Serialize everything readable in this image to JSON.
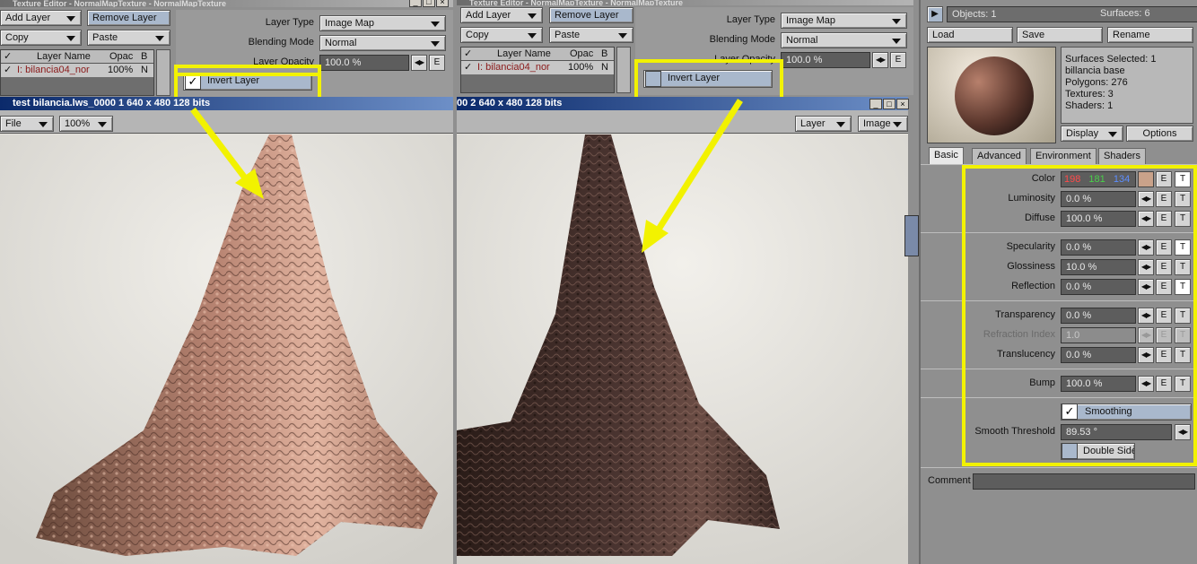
{
  "te1": {
    "title": "Texture Editor - NormalMapTexture - NormalMapTexture",
    "add_layer": "Add Layer",
    "remove_layer": "Remove Layer",
    "copy": "Copy",
    "paste": "Paste",
    "col_layer_name": "Layer Name",
    "col_opac": "Opac",
    "col_b": "B",
    "row_name": "I: bilancia04_nor",
    "row_opac": "100%",
    "row_b": "N",
    "layer_type_label": "Layer Type",
    "layer_type_value": "Image Map",
    "blending_mode_label": "Blending Mode",
    "blending_mode_value": "Normal",
    "layer_opacity_label": "Layer Opacity",
    "layer_opacity_value": "100.0 %",
    "e_label": "E",
    "invert_layer": "Invert Layer"
  },
  "te2": {
    "title": "Texture Editor - NormalMapTexture - NormalMapTexture",
    "add_layer": "Add Layer",
    "remove_layer": "Remove Layer",
    "copy": "Copy",
    "paste": "Paste",
    "col_layer_name": "Layer Name",
    "col_opac": "Opac",
    "col_b": "B",
    "row_name": "I: bilancia04_nor",
    "row_opac": "100%",
    "row_b": "N",
    "layer_type_label": "Layer Type",
    "layer_type_value": "Image Map",
    "blending_mode_label": "Blending Mode",
    "blending_mode_value": "Normal",
    "layer_opacity_label": "Layer Opacity",
    "layer_opacity_value": "100.0 %",
    "e_label": "E",
    "invert_layer": "Invert Layer"
  },
  "render1": {
    "title": "test bilancia.lws_0000 1  640 x 480 128 bits",
    "file_menu": "File",
    "zoom": "100%"
  },
  "render2": {
    "title": "00 2  640 x 480 128 bits",
    "layer_menu": "Layer",
    "image_menu": "Image"
  },
  "surface_editor": {
    "objects": "Objects: 1",
    "surfaces": "Surfaces: 6",
    "load": "Load",
    "save": "Save",
    "rename": "Rename",
    "info": [
      "Surfaces Selected: 1",
      "billancia base",
      "Polygons: 276",
      "Textures: 3",
      "Shaders: 1"
    ],
    "display": "Display",
    "options": "Options",
    "tabs": [
      "Basic",
      "Advanced",
      "Environment",
      "Shaders"
    ],
    "color_label": "Color",
    "color_r": "198",
    "color_g": "181",
    "color_b": "134",
    "swatch": "#c9a28a",
    "e": "E",
    "t": "T",
    "luminosity_label": "Luminosity",
    "luminosity_value": "0.0 %",
    "diffuse_label": "Diffuse",
    "diffuse_value": "100.0 %",
    "specularity_label": "Specularity",
    "specularity_value": "0.0 %",
    "glossiness_label": "Glossiness",
    "glossiness_value": "10.0 %",
    "reflection_label": "Reflection",
    "reflection_value": "0.0 %",
    "transparency_label": "Transparency",
    "transparency_value": "0.0 %",
    "refraction_label": "Refraction Index",
    "refraction_value": "1.0",
    "translucency_label": "Translucency",
    "translucency_value": "0.0 %",
    "bump_label": "Bump",
    "bump_value": "100.0 %",
    "smoothing": "Smoothing",
    "smooth_threshold_label": "Smooth Threshold",
    "smooth_threshold_value": "89.53 °",
    "double_sided": "Double Sided",
    "comment_label": "Comment"
  },
  "colors": {
    "highlight": "#f2f200",
    "titlebar": "#0b2a6b"
  }
}
